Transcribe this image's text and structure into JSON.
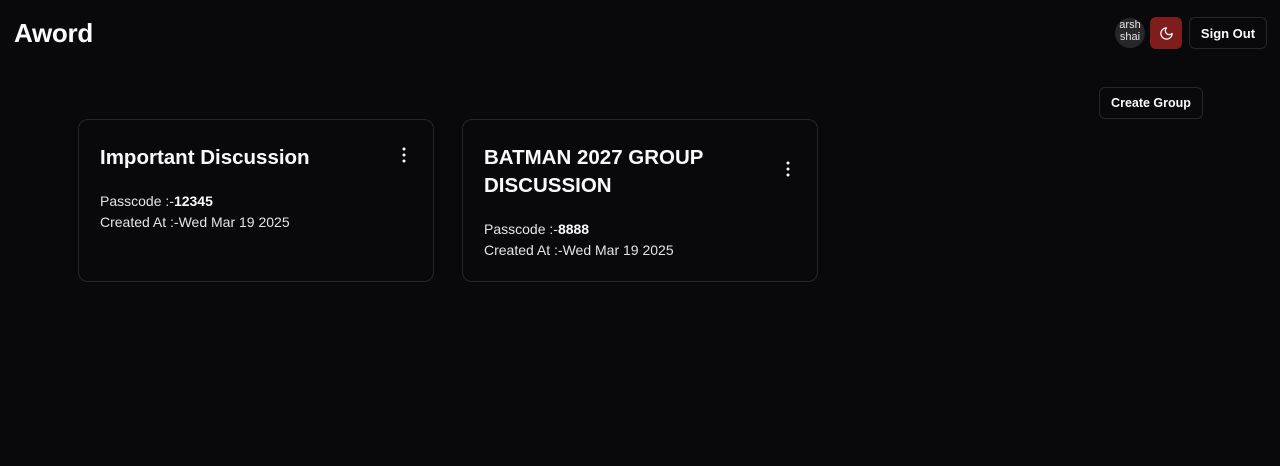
{
  "header": {
    "brand": "Aword",
    "avatar_line1": "arsh",
    "avatar_line2": "shai",
    "theme_icon": "moon-icon",
    "sign_out_label": "Sign Out"
  },
  "actions": {
    "create_group_label": "Create Group"
  },
  "colors": {
    "background": "#09090b",
    "border": "#27272a",
    "theme_button": "#7f1d1d"
  },
  "groups": [
    {
      "title": "Important Discussion",
      "passcode_label": "Passcode :-",
      "passcode": "12345",
      "created_label": "Created At :-",
      "created_at": "Wed Mar 19 2025"
    },
    {
      "title": "BATMAN 2027 GROUP DISCUSSION",
      "passcode_label": "Passcode :-",
      "passcode": "8888",
      "created_label": "Created At :-",
      "created_at": "Wed Mar 19 2025"
    }
  ]
}
